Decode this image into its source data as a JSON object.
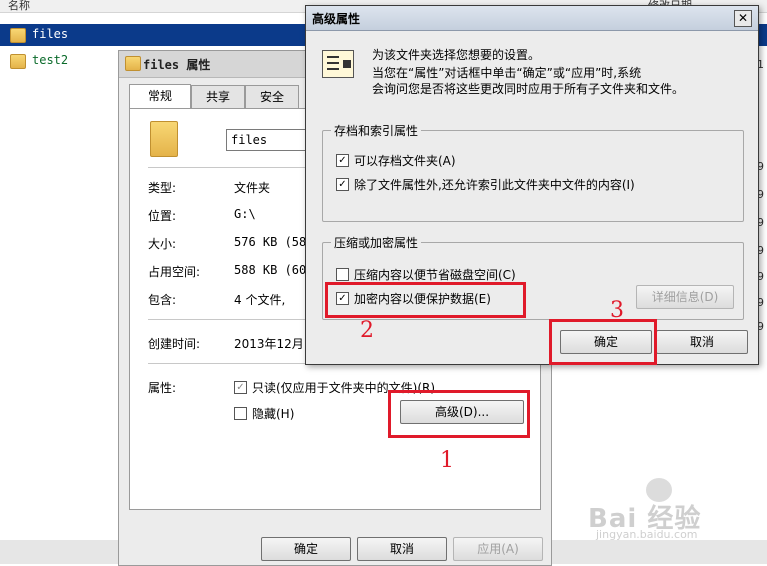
{
  "explorer": {
    "column_name": "名称",
    "column_right": "修改日期",
    "rows": [
      {
        "label": "files",
        "selected": true
      },
      {
        "label": "test2",
        "selected": false
      }
    ],
    "right_strip_nums": [
      "41",
      "1",
      "59",
      "59",
      "59",
      "89",
      "59",
      "39",
      "59"
    ]
  },
  "props_dialog": {
    "title": "files 属性",
    "tabs": [
      "常规",
      "共享",
      "安全"
    ],
    "name_value": "files",
    "rows": [
      {
        "label": "类型:",
        "value": "文件夹"
      },
      {
        "label": "位置:",
        "value": "G:\\"
      },
      {
        "label": "大小:",
        "value": "576 KB (58"
      },
      {
        "label": "占用空间:",
        "value": "588 KB (60:"
      },
      {
        "label": "包含:",
        "value": "4 个文件,"
      }
    ],
    "created_label": "创建时间:",
    "created_value": "2013年12月",
    "attributes_label": "属性:",
    "readonly_label": "只读(仅应用于文件夹中的文件)(R)",
    "hidden_label": "隐藏(H)",
    "advanced_button": "高级(D)...",
    "ok": "确定",
    "cancel": "取消",
    "apply": "应用(A)"
  },
  "advanced_dialog": {
    "title": "高级属性",
    "close_glyph": "✕",
    "description_line1": "为该文件夹选择您想要的设置。",
    "description_line2": "当您在“属性”对话框中单击“确定”或“应用”时,系统",
    "description_line3": "会询问您是否将这些更改同时应用于所有子文件夹和文件。",
    "archive_group": "存档和索引属性",
    "archive_option": "可以存档文件夹(A)",
    "index_option": "除了文件属性外,还允许索引此文件夹中文件的内容(I)",
    "compress_group": "压缩或加密属性",
    "compress_option": "压缩内容以便节省磁盘空间(C)",
    "encrypt_option": "加密内容以便保护数据(E)",
    "details_button": "详细信息(D)",
    "ok": "确定",
    "cancel": "取消",
    "checks": {
      "archive": true,
      "index": true,
      "compress": false,
      "encrypt": true
    }
  },
  "annotations": {
    "num1": "1",
    "num2": "2",
    "num3": "3",
    "color": "#e01a2a"
  },
  "watermark": {
    "brand": "Bai 经验",
    "url": "jingyan.baidu.com"
  }
}
